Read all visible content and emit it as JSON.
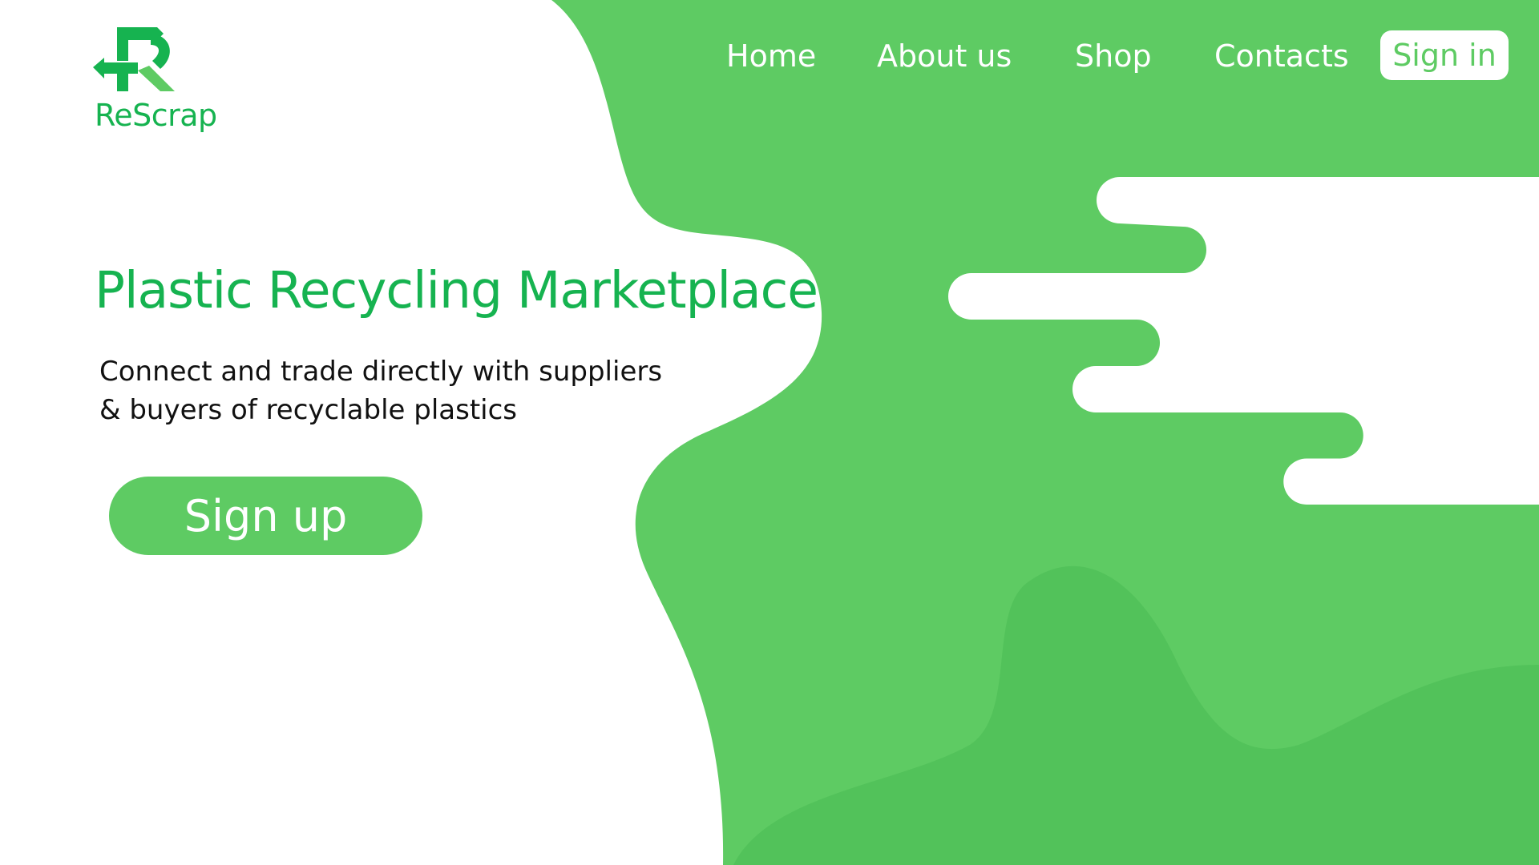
{
  "colors": {
    "brand_green": "#16b350",
    "blob_green": "#5ecb63",
    "blob_dark_green": "#52c25a",
    "white": "#ffffff",
    "text_dark": "#111111"
  },
  "logo": {
    "text": "ReScrap",
    "icon": "recycle-r-icon"
  },
  "nav": {
    "items": [
      {
        "label": "Home"
      },
      {
        "label": "About us"
      },
      {
        "label": "Shop"
      },
      {
        "label": "Contacts"
      }
    ],
    "signin_label": "Sign in"
  },
  "hero": {
    "title": "Plastic Recycling Marketplace",
    "subtitle": "Connect and trade directly with suppliers & buyers of recyclable plastics",
    "signup_label": "Sign up"
  }
}
